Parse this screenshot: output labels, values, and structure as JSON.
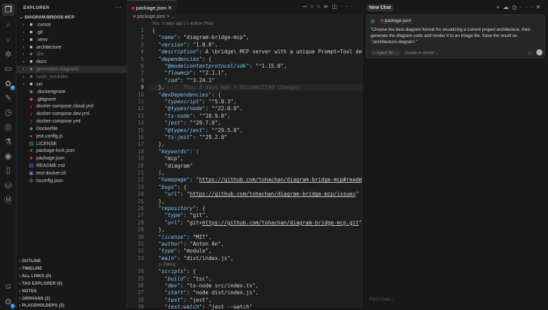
{
  "activity_bar": {
    "items": [
      {
        "icon": "files-icon",
        "active": true
      },
      {
        "icon": "search-icon"
      },
      {
        "icon": "source-control-icon"
      },
      {
        "icon": "debug-icon"
      },
      {
        "icon": "remote-explorer-icon"
      },
      {
        "icon": "extensions-icon",
        "badge": "4"
      },
      {
        "icon": "pen-icon"
      },
      {
        "icon": "timeline-icon"
      },
      {
        "icon": "git-graph-icon"
      },
      {
        "icon": "testing-icon"
      },
      {
        "icon": "target-icon"
      },
      {
        "icon": "file-icon"
      },
      {
        "icon": "database-icon"
      },
      {
        "icon": "markdown-icon"
      }
    ],
    "account_icon": "account-icon",
    "settings_icon": "gear-icon",
    "settings_badge": "1"
  },
  "explorer": {
    "title": "EXPLORER",
    "root": "DIAGRAM-BRIDGE-MCP",
    "items": [
      {
        "label": ".cursor",
        "type": "folder"
      },
      {
        "label": ".git",
        "type": "folder"
      },
      {
        "label": ".venv",
        "type": "folder"
      },
      {
        "label": "architecture",
        "type": "folder"
      },
      {
        "label": "dist",
        "type": "folder",
        "dim": true
      },
      {
        "label": "docs",
        "type": "folder"
      },
      {
        "label": "generated-diagrams",
        "type": "folder",
        "dim": true,
        "selected": true
      },
      {
        "label": "node_modules",
        "type": "folder",
        "dim": true
      },
      {
        "label": "src",
        "type": "folder"
      },
      {
        "label": ".dockerignore",
        "type": "docker"
      },
      {
        "label": ".gitignore",
        "type": "git"
      },
      {
        "label": "docker-compose.cloud.yml",
        "type": "yaml"
      },
      {
        "label": "docker-compose.dev.yml",
        "type": "yaml"
      },
      {
        "label": "docker-compose.yml",
        "type": "yaml"
      },
      {
        "label": "Dockerfile",
        "type": "docker"
      },
      {
        "label": "jest.config.js",
        "type": "jest"
      },
      {
        "label": "LICENSE",
        "type": "license"
      },
      {
        "label": "package-lock.json",
        "type": "npm"
      },
      {
        "label": "package.json",
        "type": "npm"
      },
      {
        "label": "README.md",
        "type": "md"
      },
      {
        "label": "test-docker.sh",
        "type": "sh"
      },
      {
        "label": "tsconfig.json",
        "type": "ts"
      }
    ],
    "sections": [
      "OUTLINE",
      "TIMELINE",
      "ALL LINKS (0)",
      "TAG EXPLORER (0)",
      "NOTES",
      "ORPHANS (2)",
      "PLACEHOLDERS (2)"
    ]
  },
  "editor": {
    "tab": "package.json",
    "breadcrumb": "package.json > ...",
    "blame": "You, 3 days ago | 1 author (You)",
    "inline_blame": "You, 3 days ago • Uncommitted changes",
    "current_line": 9,
    "codelens": "▷ Debug",
    "codelens_after_line": 33,
    "lines": [
      "{",
      "  \"name\": \"diagram-bridge-mcp\",",
      "  \"version\": \"1.0.0\",",
      "  \"description\": \"A \\\"bridge\\\" MCP server with a unique Prompt+Tool design",
      "  \"dependencies\": {",
      "    \"@modelcontextprotocol/sdk\": \"^1.15.0\",",
      "    \"flowmcp\": \"^2.1.1\",",
      "    \"zod\": \"^3.24.1\"",
      "  },",
      "  \"devDependencies\": {",
      "    \"typescript\": \"^5.0.3\",",
      "    \"@types/node\": \"^22.0.0\",",
      "    \"ts-node\": \"^10.9.0\",",
      "    \"jest\": \"^29.7.0\",",
      "    \"@types/jest\": \"^29.5.0\",",
      "    \"ts-jest\": \"^29.2.0\"",
      "  },",
      "  \"keywords\": [",
      "    \"mcp\",",
      "    \"diagram\"",
      "  ],",
      "  \"homepage\": \"https://github.com/tohachan/diagram-bridge-mcp#readme\",",
      "  \"bugs\": {",
      "    \"url\": \"https://github.com/tohachan/diagram-bridge-mcp/issues\"",
      "  },",
      "  \"repository\": {",
      "    \"type\": \"git\",",
      "    \"url\": \"git+https://github.com/tohachan/diagram-bridge-mcp.git\"",
      "  },",
      "  \"license\": \"MIT\",",
      "  \"author\": \"Anton An\",",
      "  \"type\": \"module\",",
      "  \"main\": \"dist/index.js\",",
      "  \"scripts\": {",
      "    \"build\": \"tsc\",",
      "    \"dev\": \"ts-node src/index.ts\",",
      "    \"start\": \"node dist/index.js\",",
      "    \"test\": \"jest\",",
      "    \"test:watch\": \"jest --watch\""
    ]
  },
  "chat": {
    "tab": "New Chat",
    "context_chip": "package.json",
    "prompt": "\"Choose the best diagram format for visualizing a current project architecture, then generate the diagram code and render it to an image file. Save the result as './architecture-diagram'.\"",
    "mode": "∞ Agent ⌘I ⌄",
    "model": "claude-4-sonnet ⌄",
    "past_chats": "Past Chats ›"
  }
}
